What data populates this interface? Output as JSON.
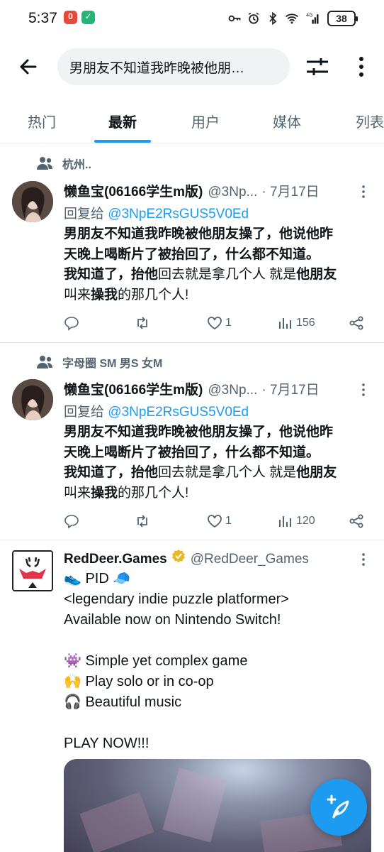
{
  "status_bar": {
    "time": "5:37",
    "battery": "38"
  },
  "search": {
    "query": "男朋友不知道我昨晚被他朋…"
  },
  "tabs": [
    {
      "label": "热门",
      "active": false
    },
    {
      "label": "最新",
      "active": true
    },
    {
      "label": "用户",
      "active": false
    },
    {
      "label": "媒体",
      "active": false
    },
    {
      "label": "列表",
      "active": false
    }
  ],
  "tweets": [
    {
      "community": "杭州..",
      "author": "懒鱼宝(06166学生m版)",
      "handle": "@3Np...",
      "date": "· 7月17日",
      "reply_prefix": "回复给",
      "reply_to": "@3NpE2RsGUS5V0Ed",
      "text_line1": "男朋友不知道我昨晚被他朋友操了，他说他昨",
      "text_line2": "天晚上喝断片了被抬回了，什么都不知道。",
      "text_line3a": "我知道了，抬他",
      "text_line3b": "回去就是拿几个人 就是",
      "text_line3c": "他朋友",
      "text_line4a": "叫来",
      "text_line4b": "操我",
      "text_line4c": "的那几个人!",
      "likes": "1",
      "views": "156"
    },
    {
      "community": "字母圈 SM 男S 女M",
      "author": "懒鱼宝(06166学生m版)",
      "handle": "@3Np...",
      "date": "· 7月17日",
      "reply_prefix": "回复给",
      "reply_to": "@3NpE2RsGUS5V0Ed",
      "text_line1": "男朋友不知道我昨晚被他朋友操了，他说他昨",
      "text_line2": "天晚上喝断片了被抬回了，什么都不知道。",
      "text_line3a": "我知道了，抬他",
      "text_line3b": "回去就是拿几个人 就是",
      "text_line3c": "他朋友",
      "text_line4a": "叫来",
      "text_line4b": "操我",
      "text_line4c": "的那几个人!",
      "likes": "1",
      "views": "120"
    }
  ],
  "promo": {
    "author": "RedDeer.Games",
    "handle": "@RedDeer_Games",
    "lines": [
      "👟 PID 🧢",
      "<legendary indie puzzle platformer>",
      "Available now on Nintendo Switch!",
      "",
      "👾 Simple yet complex game",
      "🙌 Play solo or in co-op",
      "🎧 Beautiful music",
      "",
      "PLAY NOW!!!"
    ]
  },
  "colors": {
    "accent": "#1d9bf0",
    "muted": "#536471",
    "text": "#0f1419",
    "verified_gold": "#e8b923"
  },
  "icons": [
    "back-arrow-icon",
    "filter-icon",
    "more-vertical-icon",
    "community-icon",
    "reply-icon",
    "retweet-icon",
    "like-icon",
    "views-icon",
    "share-icon",
    "verified-badge-icon",
    "compose-icon"
  ]
}
